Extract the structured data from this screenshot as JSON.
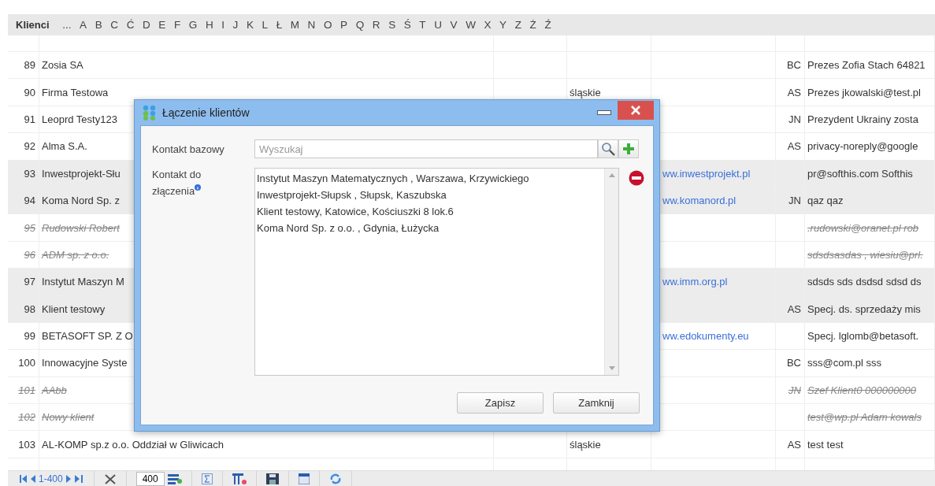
{
  "alphabet_bar": {
    "title": "Klienci",
    "letters": [
      "...",
      "A",
      "B",
      "C",
      "Ć",
      "D",
      "E",
      "F",
      "G",
      "H",
      "I",
      "J",
      "K",
      "L",
      "Ł",
      "M",
      "N",
      "O",
      "P",
      "Q",
      "R",
      "S",
      "Ś",
      "T",
      "U",
      "V",
      "W",
      "X",
      "Y",
      "Z",
      "Ż",
      "Ź"
    ]
  },
  "table": {
    "rows": [
      {
        "number": "89",
        "name": "Zosia SA",
        "initials": "BC",
        "contact": "Prezes Zofia Stach 64821",
        "selected": false,
        "deleted": false
      },
      {
        "number": "90",
        "name": "Firma Testowa",
        "region": "śląskie",
        "initials": "AS",
        "contact": "Prezes jkowalski@test.pl",
        "selected": false,
        "deleted": false
      },
      {
        "number": "91",
        "name": "Leoprd Testy123",
        "initials": "JN",
        "contact": "Prezydent Ukrainy zosta",
        "selected": false,
        "deleted": false
      },
      {
        "number": "92",
        "name": "Alma S.A.",
        "initials": "AS",
        "contact": "privacy-noreply@google",
        "selected": false,
        "deleted": false
      },
      {
        "number": "93",
        "name": "Inwestprojekt-Słu",
        "website": "ww.inwestprojekt.pl",
        "contact": "pr@softhis.com Softhis",
        "selected": true,
        "deleted": false
      },
      {
        "number": "94",
        "name": "Koma Nord Sp. z",
        "website": "ww.komanord.pl",
        "initials": "JN",
        "contact": "qaz qaz",
        "selected": true,
        "deleted": false
      },
      {
        "number": "95",
        "name": "Rudowski Robert",
        "contact": ".rudowski@oranet.pl rob",
        "selected": false,
        "deleted": true
      },
      {
        "number": "96",
        "name": "ADM sp. z o.o.",
        "contact": "sdsdsasdas , wiesiu@prl.",
        "selected": false,
        "deleted": true
      },
      {
        "number": "97",
        "name": "Instytut Maszyn M",
        "website": "ww.imm.org.pl",
        "contact": "sdsds sds dsdsd sdsd ds",
        "selected": true,
        "deleted": false
      },
      {
        "number": "98",
        "name": "Klient testowy",
        "initials": "AS",
        "contact": "Specj. ds. sprzedaży mis",
        "selected": true,
        "deleted": false
      },
      {
        "number": "99",
        "name": "BETASOFT SP. Z O",
        "website": "ww.edokumenty.eu",
        "contact": "Specj. lglomb@betasoft.",
        "selected": false,
        "deleted": false
      },
      {
        "number": "100",
        "name": "Innowacyjne Syste",
        "initials": "BC",
        "contact": "sss@com.pl sss",
        "selected": false,
        "deleted": false
      },
      {
        "number": "101",
        "name": "AAbb",
        "initials": "JN",
        "contact": "Szef Klient0 000000000",
        "selected": false,
        "deleted": true
      },
      {
        "number": "102",
        "name": "Nowy klient",
        "contact": "test@wp.pl Adam kowals",
        "selected": false,
        "deleted": true
      },
      {
        "number": "103",
        "name": "AL-KOMP sp.z o.o. Oddział w Gliwicach",
        "region": "śląskie",
        "initials": "AS",
        "contact": "test test",
        "selected": false,
        "deleted": false
      }
    ]
  },
  "pager": {
    "range": "1-400",
    "page_size": "400"
  },
  "dialog": {
    "title": "Łączenie klientów",
    "base_label": "Kontakt bazowy",
    "search_placeholder": "Wyszukaj",
    "merge_label": "Kontakt do złączenia",
    "merge_items": [
      "Instytut Maszyn Matematycznych , Warszawa, Krzywickiego",
      "Inwestprojekt-Słupsk , Słupsk, Kaszubska",
      "Klient testowy, Katowice, Kościuszki 8 lok.6",
      "Koma Nord Sp. z o.o. , Gdynia, Łużycka"
    ],
    "buttons": [
      "Zapisz",
      "Zamknij"
    ]
  }
}
